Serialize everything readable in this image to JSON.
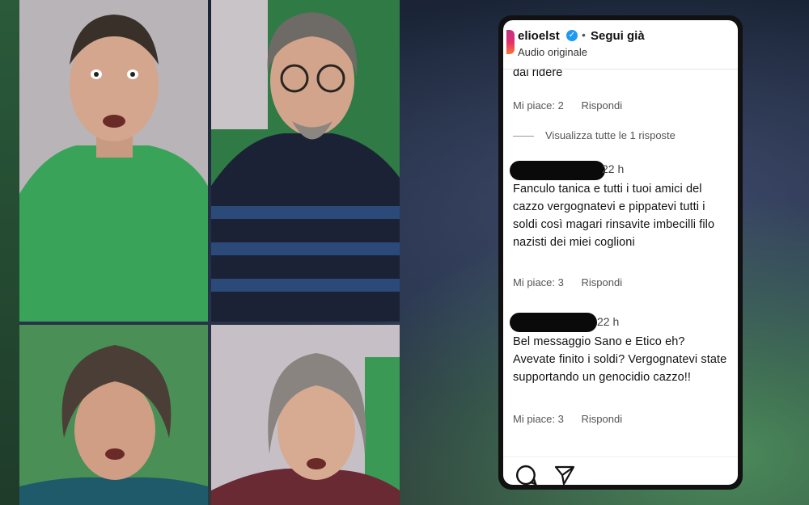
{
  "post": {
    "username": "elioelst",
    "verified_icon": "verified-badge-icon",
    "separator": "•",
    "follow_label": "Segui già",
    "audio_label": "Audio originale"
  },
  "comments": [
    {
      "text_fragment": "dai ridere",
      "likes": "Mi piace: 2",
      "reply": "Rispondi"
    },
    {
      "time": "22 h",
      "text": "Fanculo tanica e tutti i tuoi amici del cazzo vergognatevi e pippatevi tutti i soldi così magari rinsavite imbecilli filo nazisti dei miei coglioni",
      "likes": "Mi piace: 3",
      "reply": "Rispondi"
    },
    {
      "time": "22 h",
      "text": "Bel messaggio Sano e Etico eh? Avevate finito i soldi? Vergognatevi state supportando un genocidio cazzo!!",
      "likes": "Mi piace: 3",
      "reply": "Rispondi"
    }
  ],
  "view_all_replies": "Visualizza tutte le 1 risposte",
  "footer": {
    "icons": [
      "comment-icon",
      "share-icon"
    ]
  }
}
